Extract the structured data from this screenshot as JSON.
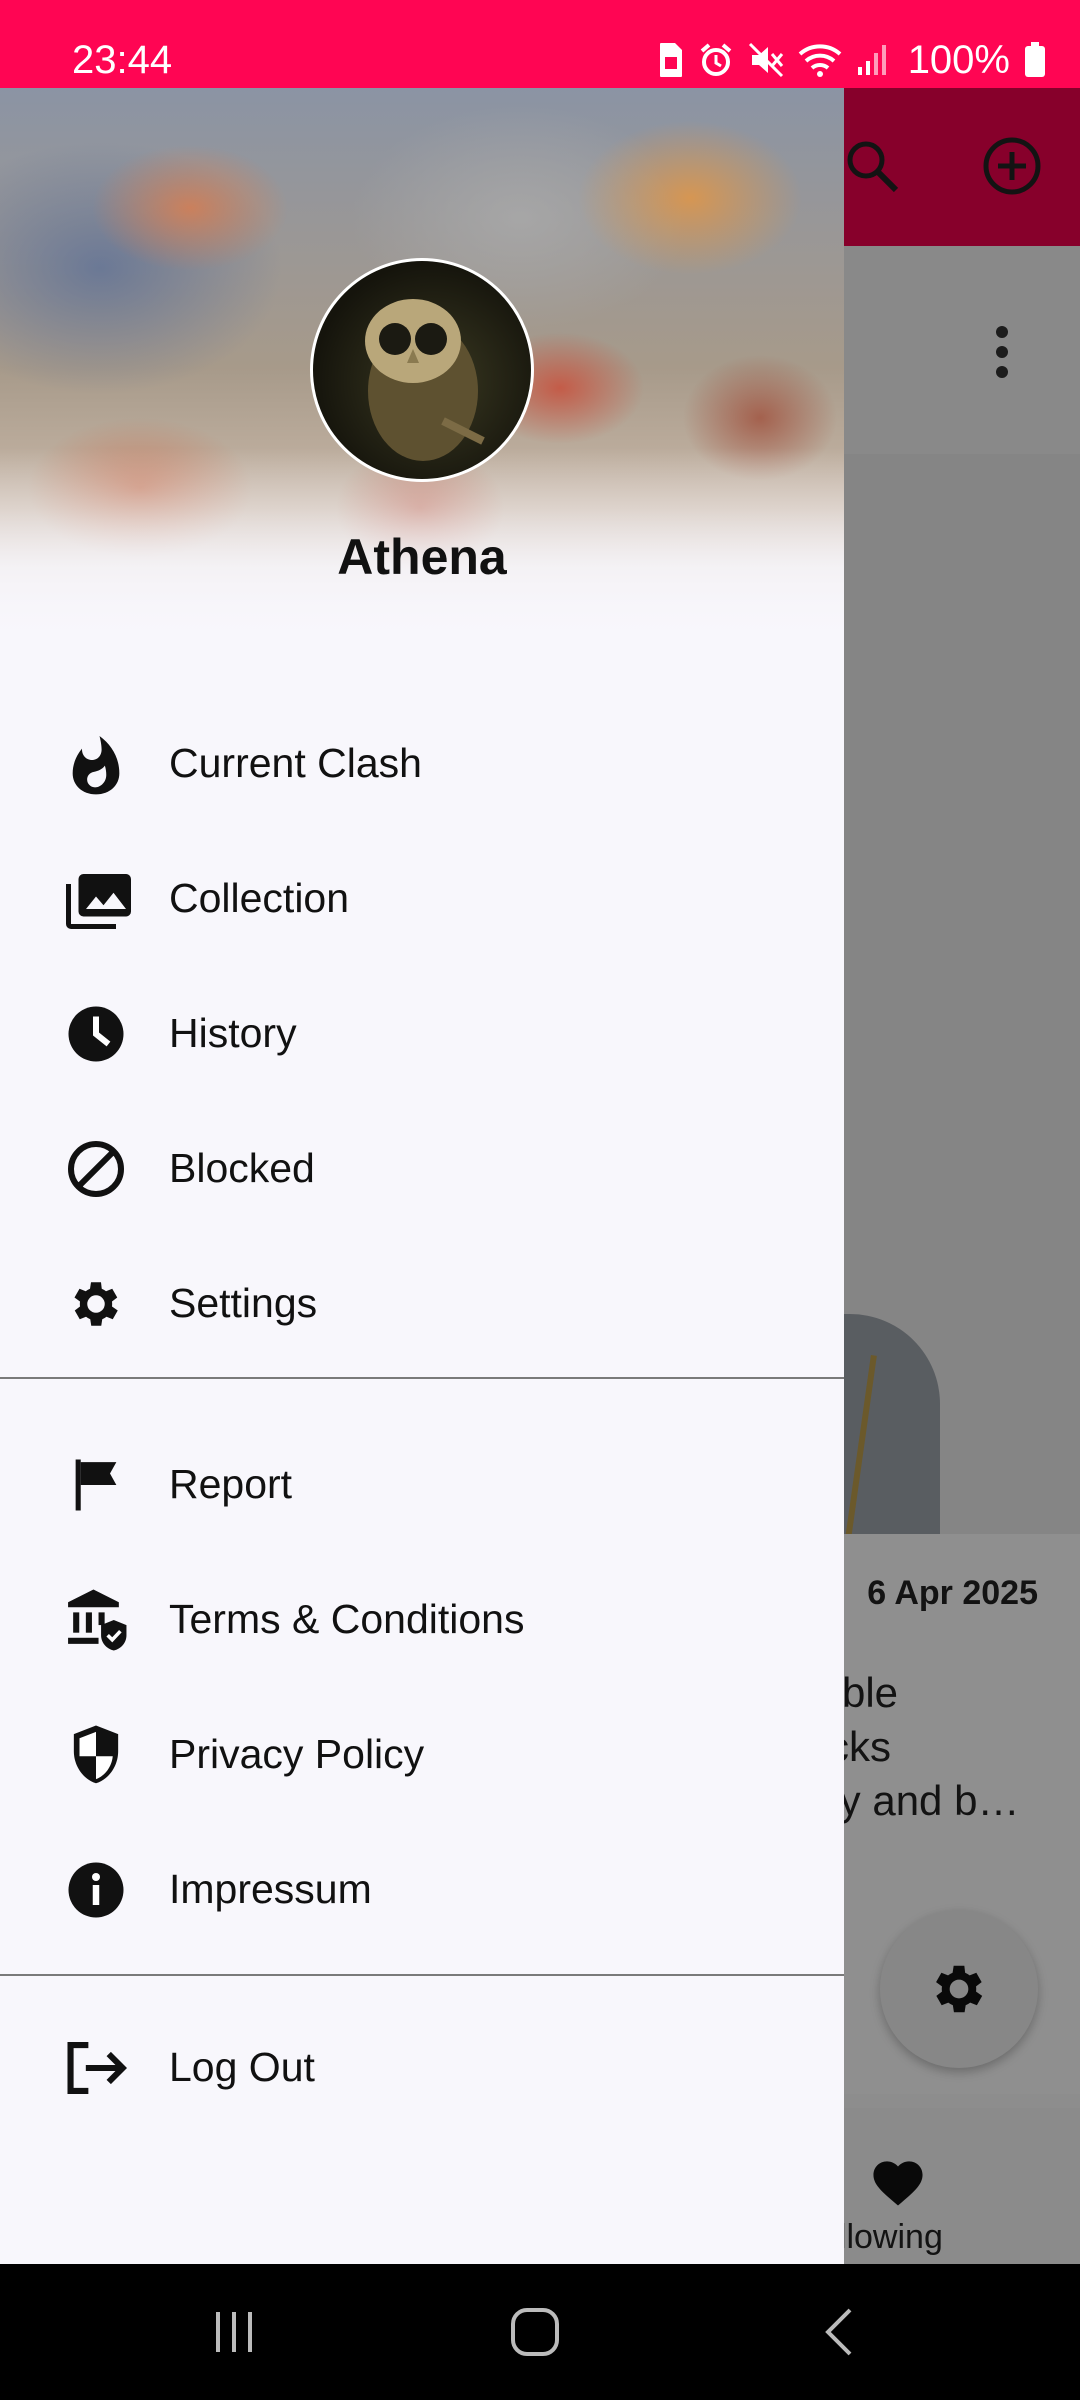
{
  "status_bar": {
    "time": "23:44",
    "battery": "100%",
    "background_color": "#ff0553"
  },
  "background_app": {
    "toolbar_color": "#e8004b",
    "date": "6 Apr 2025",
    "description": "rble\ncks\nty and b…",
    "bottom_nav_label": "ollowing",
    "icons": [
      "search-icon",
      "add-circle-icon",
      "more-vert-icon",
      "gear-icon",
      "heart-icon"
    ]
  },
  "drawer": {
    "user_name": "Athena",
    "menu_group_1": [
      {
        "label": "Current Clash",
        "icon": "fire-icon"
      },
      {
        "label": "Collection",
        "icon": "collection-icon"
      },
      {
        "label": "History",
        "icon": "clock-icon"
      },
      {
        "label": "Blocked",
        "icon": "block-icon"
      },
      {
        "label": "Settings",
        "icon": "gear-icon"
      }
    ],
    "menu_group_2": [
      {
        "label": "Report",
        "icon": "flag-icon"
      },
      {
        "label": "Terms & Conditions",
        "icon": "institution-icon"
      },
      {
        "label": "Privacy Policy",
        "icon": "shield-icon"
      },
      {
        "label": "Impressum",
        "icon": "info-icon"
      }
    ],
    "menu_group_3": [
      {
        "label": "Log Out",
        "icon": "logout-icon"
      }
    ]
  }
}
